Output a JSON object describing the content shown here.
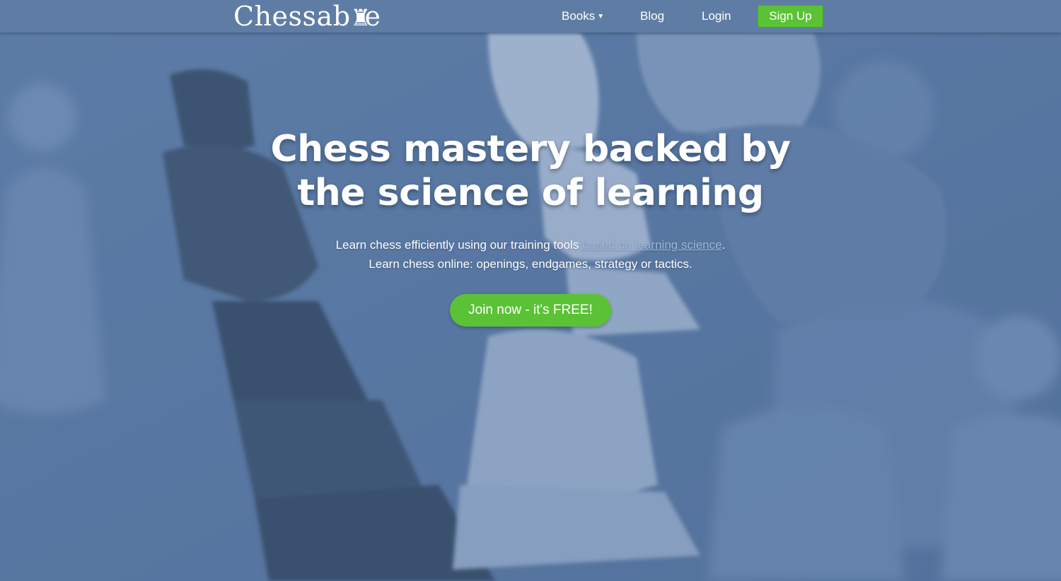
{
  "header": {
    "logo_text": "Chessab",
    "logo_rook": "♜",
    "logo_suffix": "e",
    "nav": {
      "books_label": "Books",
      "blog_label": "Blog",
      "login_label": "Login",
      "signup_label": "Sign Up"
    }
  },
  "hero": {
    "headline_line1": "Chess mastery backed by",
    "headline_line2": "the science of learning",
    "sub_line1_prefix": "Learn chess efficiently using our training tools",
    "sub_line1_link": "based on learning science",
    "sub_line1_suffix": ".",
    "sub_line2": "Learn chess online: openings, endgames, strategy or tactics.",
    "cta_label": "Join now - it's FREE!"
  },
  "colors": {
    "background": "#5a7aa3",
    "header": "#5f7da4",
    "accent_green": "#5bc236"
  }
}
